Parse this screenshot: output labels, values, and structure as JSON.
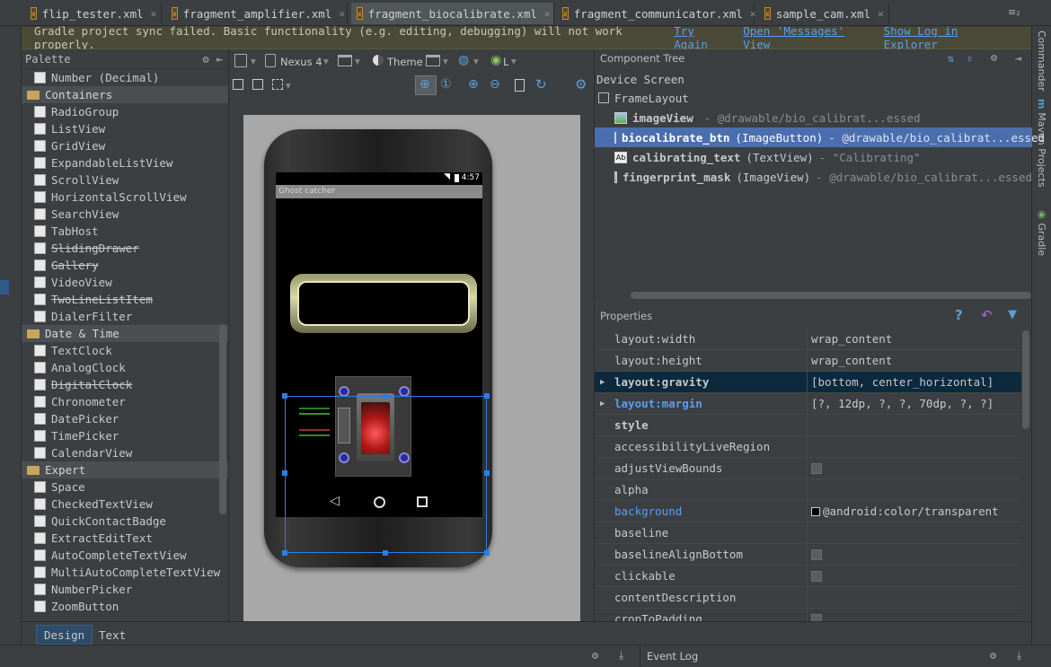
{
  "tabs": [
    {
      "label": "flip_tester.xml",
      "active": false
    },
    {
      "label": "fragment_amplifier.xml",
      "active": false
    },
    {
      "label": "fragment_biocalibrate.xml",
      "active": true
    },
    {
      "label": "fragment_communicator.xml",
      "active": false
    },
    {
      "label": "sample_cam.xml",
      "active": false
    }
  ],
  "tab_overflow": "≡₂",
  "banner": {
    "message": "Gradle project sync failed. Basic functionality (e.g. editing, debugging) will not work properly.",
    "links": [
      "Try Again",
      "Open 'Messages' View",
      "Show Log in Explorer"
    ]
  },
  "right_tools": [
    "Commander",
    "Maven Projects",
    "Gradle"
  ],
  "palette": {
    "title": "Palette",
    "rows": [
      {
        "type": "item",
        "label": "Number (Decimal)"
      },
      {
        "type": "group",
        "label": "Containers"
      },
      {
        "type": "item",
        "label": "RadioGroup"
      },
      {
        "type": "item",
        "label": "ListView"
      },
      {
        "type": "item",
        "label": "GridView"
      },
      {
        "type": "item",
        "label": "ExpandableListView"
      },
      {
        "type": "item",
        "label": "ScrollView"
      },
      {
        "type": "item",
        "label": "HorizontalScrollView"
      },
      {
        "type": "item",
        "label": "SearchView"
      },
      {
        "type": "item",
        "label": "TabHost"
      },
      {
        "type": "item",
        "label": "SlidingDrawer",
        "deprecated": true
      },
      {
        "type": "item",
        "label": "Gallery",
        "deprecated": true
      },
      {
        "type": "item",
        "label": "VideoView"
      },
      {
        "type": "item",
        "label": "TwoLineListItem",
        "deprecated": true
      },
      {
        "type": "item",
        "label": "DialerFilter"
      },
      {
        "type": "group",
        "label": "Date & Time"
      },
      {
        "type": "item",
        "label": "TextClock"
      },
      {
        "type": "item",
        "label": "AnalogClock"
      },
      {
        "type": "item",
        "label": "DigitalClock",
        "deprecated": true
      },
      {
        "type": "item",
        "label": "Chronometer"
      },
      {
        "type": "item",
        "label": "DatePicker"
      },
      {
        "type": "item",
        "label": "TimePicker"
      },
      {
        "type": "item",
        "label": "CalendarView"
      },
      {
        "type": "group",
        "label": "Expert"
      },
      {
        "type": "item",
        "label": "Space"
      },
      {
        "type": "item",
        "label": "CheckedTextView"
      },
      {
        "type": "item",
        "label": "QuickContactBadge"
      },
      {
        "type": "item",
        "label": "ExtractEditText"
      },
      {
        "type": "item",
        "label": "AutoCompleteTextView"
      },
      {
        "type": "item",
        "label": "MultiAutoCompleteTextView"
      },
      {
        "type": "item",
        "label": "NumberPicker"
      },
      {
        "type": "item",
        "label": "ZoomButton"
      }
    ]
  },
  "designer": {
    "device": "Nexus 4",
    "theme": "Theme",
    "api": "L",
    "status_time": "4:57",
    "app_title": "Ghost catcher"
  },
  "component_tree": {
    "title": "Component Tree",
    "root": "Device Screen",
    "layout": "FrameLayout",
    "nodes": [
      {
        "name": "imageView",
        "type": "",
        "value": "- @drawable/bio_calibrat...essed",
        "selected": false
      },
      {
        "name": "biocalibrate_btn",
        "type": "(ImageButton)",
        "value": "- @drawable/bio_calibrat...essed",
        "selected": true
      },
      {
        "name": "calibrating_text",
        "type": "(TextView)",
        "value": "- \"Calibrating\"",
        "selected": false
      },
      {
        "name": "fingerprint_mask",
        "type": "(ImageView)",
        "value": "- @drawable/bio_calibrat...essed",
        "selected": false
      }
    ]
  },
  "properties": {
    "title": "Properties",
    "rows": [
      {
        "key": "layout:width",
        "value": "wrap_content",
        "kind": "text"
      },
      {
        "key": "layout:height",
        "value": "wrap_content",
        "kind": "text"
      },
      {
        "key": "layout:gravity",
        "value": "[bottom, center_horizontal]",
        "kind": "text",
        "expandable": true,
        "highlight": true
      },
      {
        "key": "layout:margin",
        "value": "[?, 12dp, ?, ?, 70dp, ?, ?]",
        "kind": "text",
        "expandable": true,
        "blue": true
      },
      {
        "key": "style",
        "value": "",
        "kind": "text",
        "bold": true
      },
      {
        "key": "accessibilityLiveRegion",
        "value": "",
        "kind": "text"
      },
      {
        "key": "adjustViewBounds",
        "value": "",
        "kind": "check"
      },
      {
        "key": "alpha",
        "value": "",
        "kind": "text"
      },
      {
        "key": "background",
        "value": "@android:color/transparent",
        "kind": "color",
        "blue": true
      },
      {
        "key": "baseline",
        "value": "",
        "kind": "text"
      },
      {
        "key": "baselineAlignBottom",
        "value": "",
        "kind": "check"
      },
      {
        "key": "clickable",
        "value": "",
        "kind": "check"
      },
      {
        "key": "contentDescription",
        "value": "",
        "kind": "text"
      },
      {
        "key": "cropToPadding",
        "value": "",
        "kind": "check"
      }
    ]
  },
  "bottom_tabs": [
    "Design",
    "Text"
  ],
  "event_log": "Event Log"
}
